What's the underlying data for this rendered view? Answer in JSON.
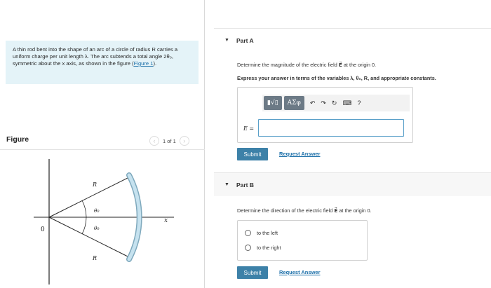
{
  "problem": {
    "text": "A thin rod bent into the shape of an arc of a circle of radius R carries a uniform charge per unit length λ. The arc subtends a total angle 2θ₀, symmetric about the x axis, as shown in the figure (",
    "figure_link": "Figure 1",
    "text_end": ")."
  },
  "figure": {
    "label": "Figure",
    "pager_text": "1 of 1",
    "prev_icon": "chevron-left-icon",
    "next_icon": "chevron-right-icon",
    "labels": {
      "origin": "0",
      "x_axis": "x",
      "r_top": "R",
      "r_bottom": "R",
      "theta_top": "θ₀",
      "theta_bottom": "θ₀"
    }
  },
  "partA": {
    "header": "Part A",
    "question_pre": "Determine the magnitude of the electric field ",
    "vector": "E⃗",
    "question_post": " at the origin 0.",
    "instruction": "Express your answer in terms of the variables λ, θ₀, R, and appropriate constants.",
    "toolbar": {
      "templates_label": "▮√▯",
      "symbols_label": "ΑΣφ",
      "undo": "↶",
      "redo": "↷",
      "reset": "↻",
      "keyboard": "⌨",
      "help": "?"
    },
    "answer_label": "E =",
    "answer_value": "",
    "submit_label": "Submit",
    "request_label": "Request Answer"
  },
  "partB": {
    "header": "Part B",
    "question_pre": "Determine the direction of the electric field ",
    "vector": "E⃗",
    "question_post": " at the origin 0.",
    "options": [
      "to the left",
      "to the right"
    ],
    "submit_label": "Submit",
    "request_label": "Request Answer"
  },
  "colors": {
    "accent": "#3d81a8",
    "link": "#1a6ea8",
    "problem_bg": "#e4f3f8",
    "arc": "#a8cde0"
  }
}
